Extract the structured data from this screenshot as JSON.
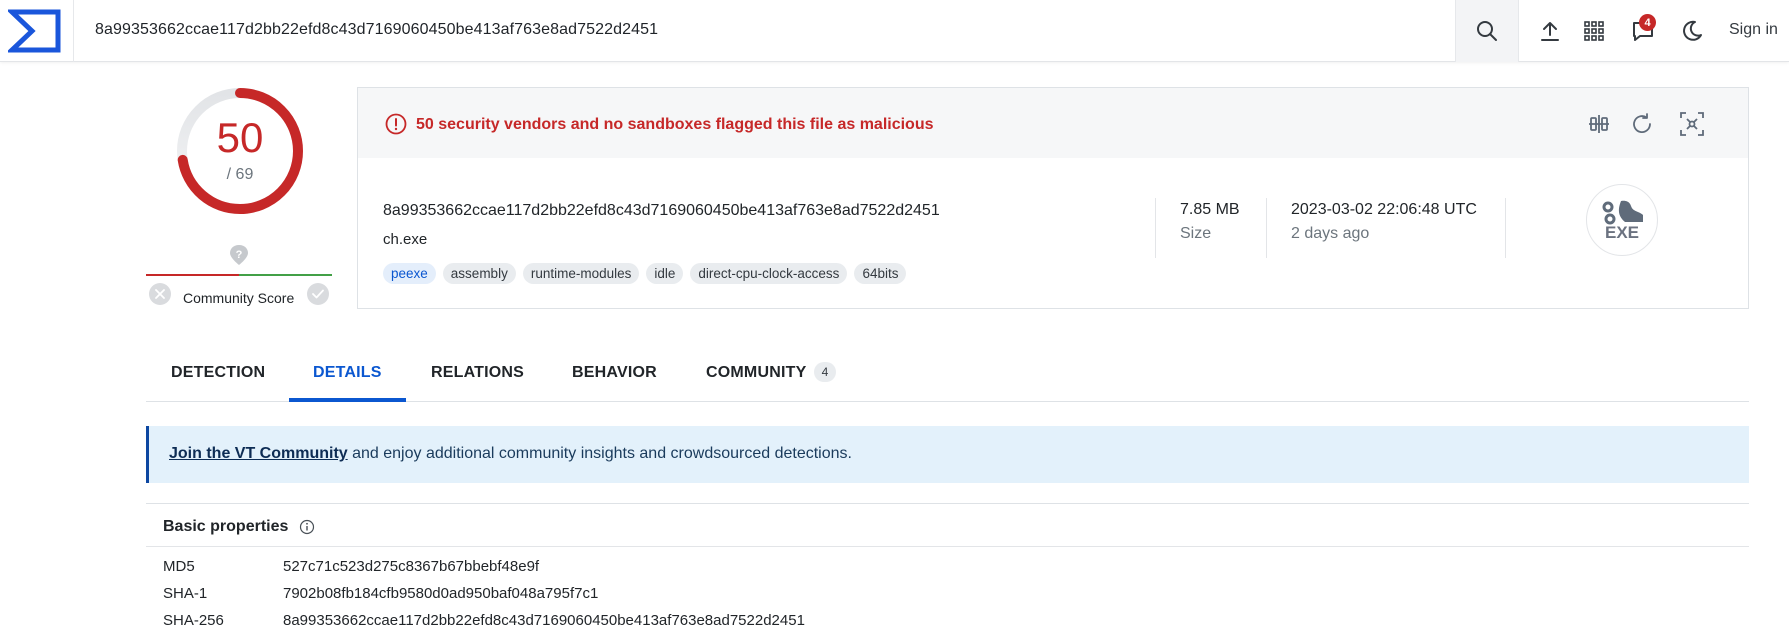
{
  "search": {
    "value": "8a99353662ccae117d2bb22efd8c43d7169060450be413af763e8ad7522d2451"
  },
  "topbar": {
    "notifications_count": "4",
    "signin_label": "Sign in"
  },
  "score": {
    "detections": "50",
    "total": "/ 69",
    "fraction": 0.7246
  },
  "community": {
    "label": "Community Score"
  },
  "alert": {
    "text": "50 security vendors and no sandboxes flagged this file as malicious"
  },
  "file": {
    "hash": "8a99353662ccae117d2bb22efd8c43d7169060450be413af763e8ad7522d2451",
    "name": "ch.exe",
    "tags": [
      "peexe",
      "assembly",
      "runtime-modules",
      "idle",
      "direct-cpu-clock-access",
      "64bits"
    ],
    "size": "7.85 MB",
    "size_label": "Size",
    "date": "2023-03-02 22:06:48 UTC",
    "date_relative": "2 days ago",
    "type_icon_label": "EXE"
  },
  "tabs": [
    {
      "label": "DETECTION"
    },
    {
      "label": "DETAILS"
    },
    {
      "label": "RELATIONS"
    },
    {
      "label": "BEHAVIOR"
    },
    {
      "label": "COMMUNITY",
      "count": "4"
    }
  ],
  "banner": {
    "link": "Join the VT Community",
    "text": " and enjoy additional community insights and crowdsourced detections."
  },
  "basic_properties": {
    "title": "Basic properties",
    "rows": [
      {
        "label": "MD5",
        "value": "527c71c523d275c8367b67bbebf48e9f"
      },
      {
        "label": "SHA-1",
        "value": "7902b08fb184cfb9580d0ad950baf048a795f7c1"
      },
      {
        "label": "SHA-256",
        "value": "8a99353662ccae117d2bb22efd8c43d7169060450be413af763e8ad7522d2451"
      }
    ]
  },
  "colors": {
    "accent": "#0b57d0",
    "danger": "#c62828",
    "success": "#43a047"
  }
}
